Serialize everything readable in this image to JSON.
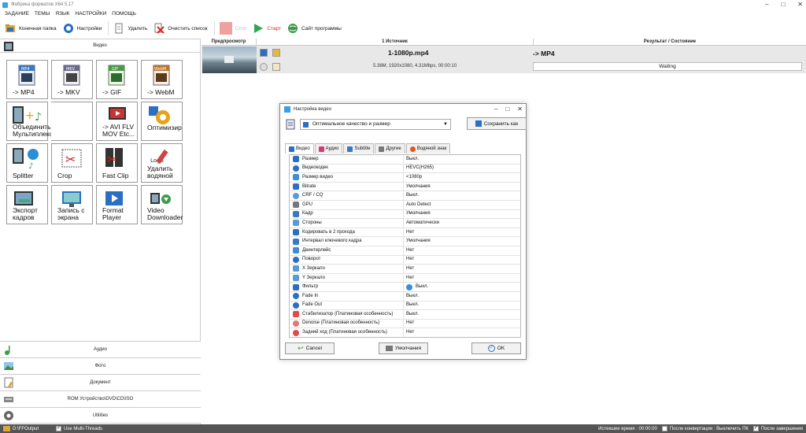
{
  "window": {
    "title": "Фабрика форматов X64 5.17"
  },
  "menu": [
    "ЗАДАНИЕ",
    "ТЕМЫ",
    "ЯЗЫК",
    "НАСТРОЙКИ",
    "ПОМОЩЬ"
  ],
  "toolbar": {
    "output_folder": "Конечная папка",
    "settings": "Настройки",
    "delete": "Удалить",
    "clear_list": "Очистить список",
    "stop": "Стоп",
    "start": "Старт",
    "website": "Сайт программы"
  },
  "sidebar": {
    "video_header": "Видео",
    "tiles": [
      {
        "label": "-> MP4",
        "icon": "mp4-file-icon"
      },
      {
        "label": "-> MKV",
        "icon": "mkv-file-icon"
      },
      {
        "label": "-> GIF",
        "icon": "gif-file-icon"
      },
      {
        "label": "-> WebM",
        "icon": "webm-file-icon"
      },
      {
        "label": "Объединить видео & Мультиплексор",
        "icon": "join-video-icon"
      },
      {
        "label": "-> AVI FLV MOV Etc...",
        "icon": "video-formats-icon"
      },
      {
        "label": "Оптимизиро",
        "icon": "optimize-icon"
      },
      {
        "label": "Splitter",
        "icon": "splitter-icon"
      },
      {
        "label": "Crop",
        "icon": "crop-icon"
      },
      {
        "label": "Fast Clip",
        "icon": "fast-clip-icon"
      },
      {
        "label": "Удалить водяной",
        "icon": "remove-watermark-icon"
      },
      {
        "label": "Экспорт кадров",
        "icon": "export-frames-icon"
      },
      {
        "label": "Запись с экрана",
        "icon": "screen-record-icon"
      },
      {
        "label": "Format Player",
        "icon": "format-player-icon"
      },
      {
        "label": "Video Downloader",
        "icon": "video-downloader-icon"
      }
    ],
    "categories": [
      "Аудио",
      "Фото",
      "Документ",
      "ROM Устройство\\DVD\\CD\\ISO",
      "Utilities"
    ]
  },
  "filelist": {
    "columns": [
      "Предпросмотр",
      "1 Источник",
      "Результат / Состояние"
    ],
    "rows": [
      {
        "source_name": "1-1080p.mp4",
        "source_info": "5.38M, 1920x1080, 4.31Mbps, 00:00:10",
        "result_name": "-> MP4",
        "status": "Waiting"
      }
    ]
  },
  "dialog": {
    "title": "Настройка видео",
    "preset": "Оптимальное качество и размер",
    "save_as": "Сохранить как",
    "tabs": [
      "Видео",
      "Аудио",
      "Subtitle",
      "Другие",
      "Водяной знак"
    ],
    "params": [
      {
        "name": "Размер",
        "value": "Выкл."
      },
      {
        "name": "Видеокодек",
        "value": "HEVC(H265)"
      },
      {
        "name": "Размер видео",
        "value": "<1080p"
      },
      {
        "name": "Bitrate",
        "value": "Умолчания"
      },
      {
        "name": "CRF / CQ",
        "value": "Выкл."
      },
      {
        "name": "GPU",
        "value": "Auto Detect"
      },
      {
        "name": "Кадр",
        "value": "Умолчания"
      },
      {
        "name": "Стороны",
        "value": "Автоматически"
      },
      {
        "name": "Кодировать в 2 прохода",
        "value": "Нет"
      },
      {
        "name": "Интервал ключевого кадра",
        "value": "Умолчания"
      },
      {
        "name": "Деинтерлейс",
        "value": "Нет"
      },
      {
        "name": "Поворот",
        "value": "Нет"
      },
      {
        "name": "X Зеркало",
        "value": "Нет"
      },
      {
        "name": "Y Зеркало",
        "value": "Нет"
      },
      {
        "name": "Фильтр",
        "value": "Выкл."
      },
      {
        "name": "Fade In",
        "value": "Выкл."
      },
      {
        "name": "Fade Out",
        "value": "Выкл."
      },
      {
        "name": "Стабилизатор (Платиновая особенность)",
        "value": "Выкл."
      },
      {
        "name": "Denoise (Платиновая особенность)",
        "value": "Нет"
      },
      {
        "name": "Задний ход (Платиновая особенность)",
        "value": "Нет"
      }
    ],
    "cancel": "Cancel",
    "defaults": "Умолчания",
    "ok": "OK"
  },
  "statusbar": {
    "output_path": "D:\\FFOutput",
    "multithreads": "Use Multi-Threads",
    "elapsed": "Истекшее время : 00:00:00",
    "after_convert": "После конвертации : Выключить ПК",
    "after_finish": "После завершения"
  },
  "colors": {
    "statusbar": "#555555",
    "row_bg": "#e8e8e8",
    "start_green": "#2fa84f",
    "stop_red": "#e05555"
  }
}
